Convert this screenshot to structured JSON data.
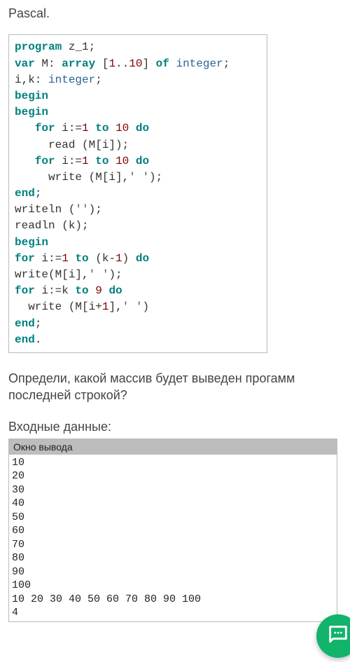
{
  "intro_text": "Pascal.",
  "code": {
    "line1_kw1": "program",
    "line1_ident": " z_1;",
    "line2_kw1": "var",
    "line2_txt1": " M: ",
    "line2_kw2": "array",
    "line2_txt2": " [",
    "line2_n1": "1",
    "line2_txt3": "..",
    "line2_n2": "10",
    "line2_txt4": "] ",
    "line2_kw3": "of",
    "line2_txt5": " ",
    "line2_ty": "integer",
    "line2_txt6": ";",
    "line3_txt1": "i,k: ",
    "line3_ty": "integer",
    "line3_txt2": ";",
    "line4_kw": "begin",
    "line5_kw": "begin",
    "line6_txt1": "   ",
    "line6_kw1": "for",
    "line6_txt2": " i:=",
    "line6_n1": "1",
    "line6_txt3": " ",
    "line6_kw2": "to",
    "line6_txt4": " ",
    "line6_n2": "10",
    "line6_txt5": " ",
    "line6_kw3": "do",
    "line7_txt1": "     read (M[i]);",
    "line8_txt1": "   ",
    "line8_kw1": "for",
    "line8_txt2": " i:=",
    "line8_n1": "1",
    "line8_txt3": " ",
    "line8_kw2": "to",
    "line8_txt4": " ",
    "line8_n2": "10",
    "line8_txt5": " ",
    "line8_kw3": "do",
    "line9_txt1": "     write (M[i],",
    "line9_str": "' '",
    "line9_txt2": ");",
    "line10_kw": "end",
    "line10_txt": ";",
    "line11_txt1": "writeln (",
    "line11_str": "''",
    "line11_txt2": ");",
    "line12_txt": "readln (k);",
    "line13_kw": "begin",
    "line14_kw1": "for",
    "line14_txt1": " i:=",
    "line14_n1": "1",
    "line14_txt2": " ",
    "line14_kw2": "to",
    "line14_txt3": " (k-",
    "line14_n2": "1",
    "line14_txt4": ") ",
    "line14_kw3": "do",
    "line15_txt1": "write(M[i],",
    "line15_str": "' '",
    "line15_txt2": ");",
    "line16_kw1": "for",
    "line16_txt1": " i:=k ",
    "line16_kw2": "to",
    "line16_txt2": " ",
    "line16_n1": "9",
    "line16_txt3": " ",
    "line16_kw3": "do",
    "line17_txt1": "  write (M[i+",
    "line17_n1": "1",
    "line17_txt2": "],",
    "line17_str": "' '",
    "line17_txt3": ")",
    "line18_kw": "end",
    "line18_txt": ";",
    "line19_kw": "end",
    "line19_txt": "."
  },
  "question_text": "Определи, какой массив будет выведен прогамм последней строкой?",
  "input_label": "Входные данные:",
  "output_window": {
    "header": "Окно вывода",
    "lines": [
      "10",
      "20",
      "30",
      "40",
      "50",
      "60",
      "70",
      "80",
      "90",
      "100",
      "10 20 30 40 50 60 70 80 90 100",
      "4"
    ]
  }
}
